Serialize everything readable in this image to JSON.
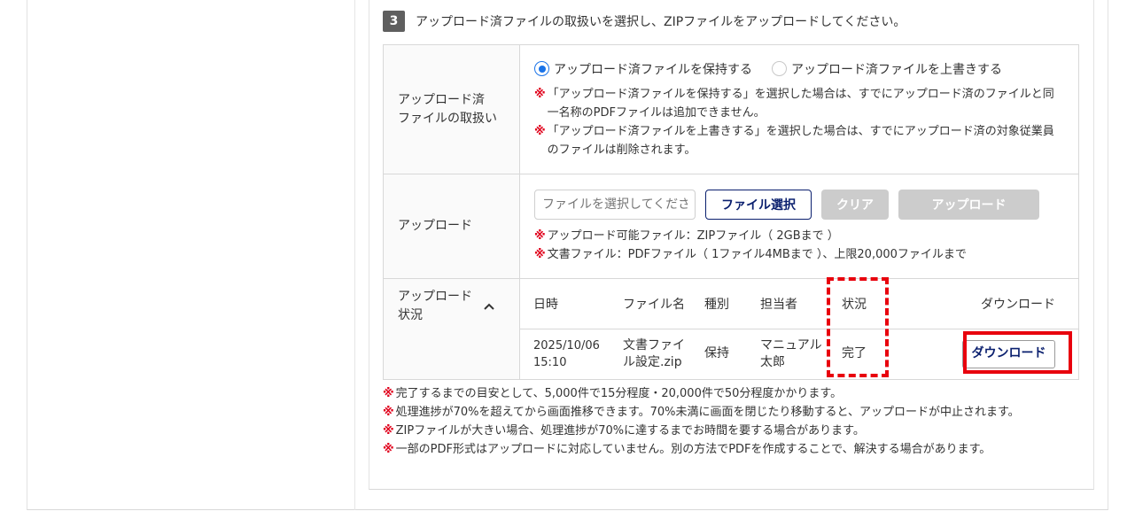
{
  "step": {
    "number": "3",
    "title": "アップロード済ファイルの取扱いを選択し、ZIPファイルをアップロードしてください。"
  },
  "handling": {
    "label_line1": "アップロード済",
    "label_line2": "ファイルの取扱い",
    "options": [
      {
        "label": "アップロード済ファイルを保持する",
        "selected": true
      },
      {
        "label": "アップロード済ファイルを上書きする",
        "selected": false
      }
    ],
    "notes": [
      {
        "mark": "※",
        "text": "「アップロード済ファイルを保持する」を選択した場合は、すでにアップロード済のファイルと同一名称のPDFファイルは追加できません。"
      },
      {
        "mark": "※",
        "text": "「アップロード済ファイルを上書きする」を選択した場合は、すでにアップロード済の対象従業員のファイルは削除されます。"
      }
    ]
  },
  "upload": {
    "label": "アップロード",
    "file_placeholder": "ファイルを選択してください",
    "select_button": "ファイル選択",
    "clear_button": "クリア",
    "upload_button": "アップロード",
    "notes": [
      {
        "mark": "※",
        "text": "アップロード可能ファイル：ZIPファイル（ 2GBまで ）"
      },
      {
        "mark": "※",
        "text": "文書ファイル：PDFファイル（ 1ファイル4MBまで ）、上限20,000ファイルまで"
      }
    ]
  },
  "status": {
    "label_line1": "アップロード",
    "label_line2": "状況",
    "icon": "chevron-up-icon",
    "columns": [
      "日時",
      "ファイル名",
      "種別",
      "担当者",
      "状況",
      "ダウンロード"
    ],
    "rows": [
      {
        "date_line1": "2025/10/06",
        "date_line2": "15:10",
        "file_line1": "文書ファイ",
        "file_line2": "ル設定.zip",
        "type": "保持",
        "staff_line1": "マニュアル",
        "staff_line2": "太郎",
        "status": "完了",
        "download_button": "ダウンロード"
      }
    ]
  },
  "bottom_notes": [
    {
      "mark": "※",
      "text": "完了するまでの目安として、5,000件で15分程度・20,000件で50分程度かかります。"
    },
    {
      "mark": "※",
      "text": "処理進捗が70%を超えてから画面推移できます。70%未満に画面を閉じたり移動すると、アップロードが中止されます。"
    },
    {
      "mark": "※",
      "text": "ZIPファイルが大きい場合、処理進捗が70%に達するまでお時間を要する場合があります。"
    },
    {
      "mark": "※",
      "text": "一部のPDF形式はアップロードに対応していません。別の方法でPDFを作成することで、解決する場合があります。"
    }
  ],
  "colors": {
    "accent": "#1a73e8",
    "navy": "#0a1f6e",
    "alert": "#e0001b",
    "highlight": "#e8000d",
    "disabled": "#cccccc"
  }
}
